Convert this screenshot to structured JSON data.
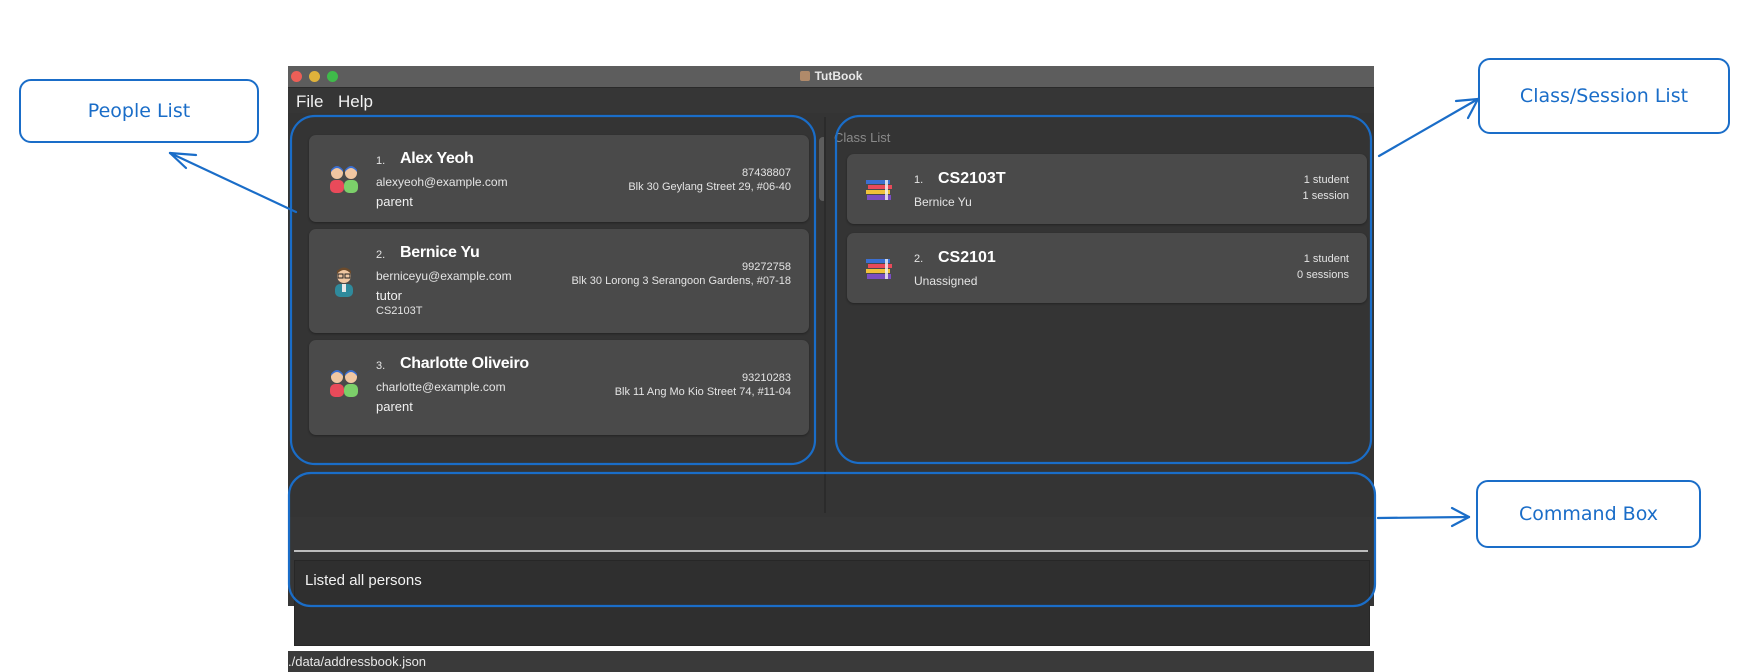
{
  "window": {
    "title": "TutBook"
  },
  "menu": {
    "items": [
      "File",
      "Help"
    ]
  },
  "people": [
    {
      "index": "1.",
      "name": "Alex Yeoh",
      "email": "alexyeoh@example.com",
      "role": "parent",
      "class": "",
      "phone": "87438807",
      "address": "Blk 30 Geylang Street 29, #06-40",
      "avatar_icon": "parent-icon"
    },
    {
      "index": "2.",
      "name": "Bernice Yu",
      "email": "berniceyu@example.com",
      "role": "tutor",
      "class": "CS2103T",
      "phone": "99272758",
      "address": "Blk 30 Lorong 3 Serangoon Gardens, #07-18",
      "avatar_icon": "tutor-icon"
    },
    {
      "index": "3.",
      "name": "Charlotte Oliveiro",
      "email": "charlotte@example.com",
      "role": "parent",
      "class": "",
      "phone": "93210283",
      "address": "Blk 11 Ang Mo Kio Street 74, #11-04",
      "avatar_icon": "parent-icon"
    }
  ],
  "class_list": {
    "title": "Class List",
    "items": [
      {
        "index": "1.",
        "code": "CS2103T",
        "tutor": "Bernice Yu",
        "students": "1 student",
        "sessions": "1 session",
        "icon": "books-icon"
      },
      {
        "index": "2.",
        "code": "CS2101",
        "tutor": "Unassigned",
        "students": "1 student",
        "sessions": "0 sessions",
        "icon": "books-icon"
      }
    ]
  },
  "result_display": {
    "text": "Listed all persons"
  },
  "status_bar": {
    "path": "./data/addressbook.json"
  },
  "annotations": {
    "people_list": "People List",
    "class_session_list": "Class/Session List",
    "command_box": "Command Box"
  },
  "colors": {
    "annotation": "#1a6dc8",
    "window_bg": "#363636",
    "card_bg": "#4a4a4a"
  }
}
